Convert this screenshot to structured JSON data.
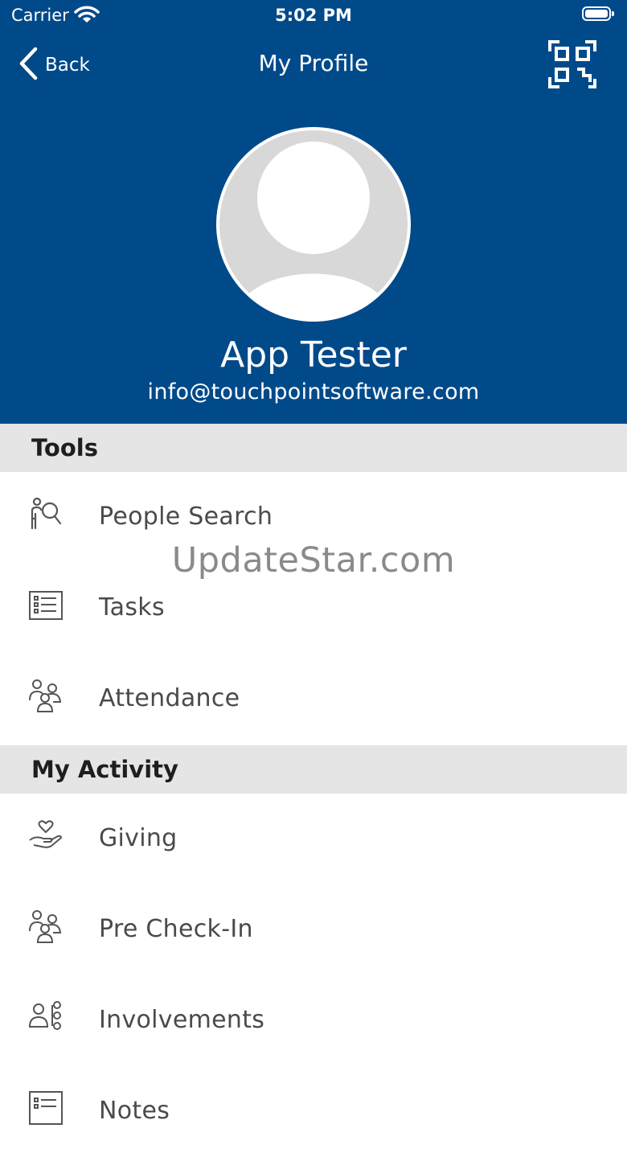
{
  "status_bar": {
    "carrier": "Carrier",
    "time": "5:02 PM"
  },
  "nav": {
    "back_label": "Back",
    "title": "My Profile",
    "qr_icon": "qr-code-scan-icon"
  },
  "profile": {
    "name": "App Tester",
    "email": "info@touchpointsoftware.com"
  },
  "sections": [
    {
      "title": "Tools",
      "items": [
        {
          "label": "People Search",
          "icon": "people-search-icon"
        },
        {
          "label": "Tasks",
          "icon": "task-list-icon"
        },
        {
          "label": "Attendance",
          "icon": "group-icon"
        }
      ]
    },
    {
      "title": "My Activity",
      "items": [
        {
          "label": "Giving",
          "icon": "heart-hand-icon"
        },
        {
          "label": "Pre Check-In",
          "icon": "group-icon"
        },
        {
          "label": "Involvements",
          "icon": "person-network-icon"
        },
        {
          "label": "Notes",
          "icon": "notes-icon"
        }
      ]
    }
  ],
  "watermark": "UpdateStar.com",
  "colors": {
    "header_bg": "#004a8a",
    "section_bg": "#e5e5e5",
    "item_text": "#4a4a4a"
  }
}
